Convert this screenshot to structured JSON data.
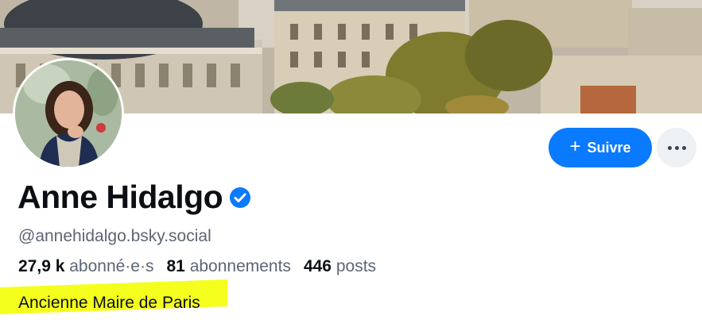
{
  "profile": {
    "display_name": "Anne Hidalgo",
    "handle": "@annehidalgo.bsky.social",
    "bio": "Ancienne Maire de Paris",
    "verified": true
  },
  "stats": {
    "followers_count": "27,9 k",
    "followers_label": "abonné·e·s",
    "following_count": "81",
    "following_label": "abonnements",
    "posts_count": "446",
    "posts_label": "posts"
  },
  "actions": {
    "follow_label": "Suivre",
    "follow_icon": "plus-icon",
    "more_icon": "more-dots-icon"
  },
  "colors": {
    "accent": "#0a7aff",
    "highlight": "#f5ff1e",
    "muted_text": "#5b6673"
  }
}
